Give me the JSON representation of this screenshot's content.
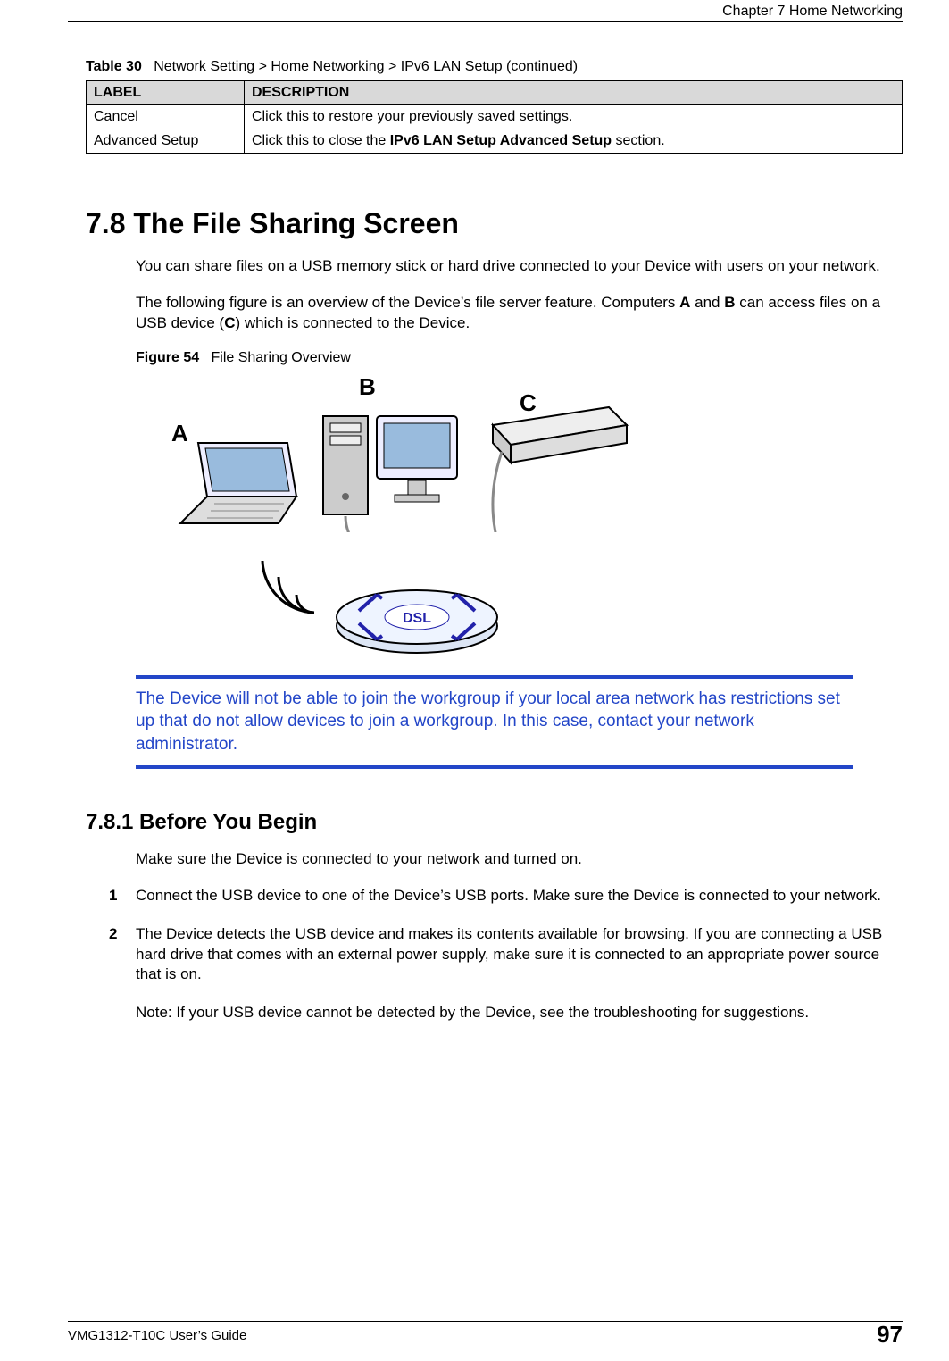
{
  "header": {
    "chapter": "Chapter 7 Home Networking"
  },
  "table": {
    "caption_prefix": "Table 30",
    "caption_body": "Network Setting > Home Networking > IPv6 LAN Setup (continued)",
    "col_label": "LABEL",
    "col_desc": "DESCRIPTION",
    "rows": [
      {
        "label": "Cancel",
        "desc_plain": "Click this to restore your previously saved settings."
      },
      {
        "label": "Advanced Setup",
        "desc_pre": "Click this to close the ",
        "desc_bold": "IPv6 LAN Setup Advanced Setup",
        "desc_post": " section."
      }
    ]
  },
  "section": {
    "number_title": "7.8  The File Sharing Screen",
    "para1": "You can share files on a USB memory stick or hard drive connected to your Device with users on your network.",
    "para2_pre": "The following figure is an overview of the Device’s file server feature. Computers ",
    "para2_A": "A",
    "para2_mid1": " and ",
    "para2_B": "B",
    "para2_mid2": " can access files on a USB device (",
    "para2_C": "C",
    "para2_post": ") which is connected to the Device."
  },
  "figure": {
    "caption_prefix": "Figure 54",
    "caption_body": "File Sharing Overview",
    "label_A": "A",
    "label_B": "B",
    "label_C": "C",
    "dsl_text": "DSL"
  },
  "callout": {
    "text": "The Device will not be able to join the workgroup if your local area network has restrictions set up that do not allow devices to join a workgroup. In this case, contact your network administrator."
  },
  "subsection": {
    "number_title": "7.8.1  Before You Begin",
    "intro": "Make sure the Device is connected to your network and turned on.",
    "steps": [
      {
        "n": "1",
        "text": "Connect the USB device to one of the Device’s USB ports. Make sure the Device is connected to your network."
      },
      {
        "n": "2",
        "text": "The Device detects the USB device and makes its contents available for browsing. If you are connecting a USB hard drive that comes with an external power supply, make sure it is connected to an appropriate power source that is on."
      }
    ],
    "note_label": "Note: ",
    "note_text": "If your USB device cannot be detected by the Device, see the troubleshooting for suggestions."
  },
  "footer": {
    "left": "VMG1312-T10C User’s Guide",
    "right": "97"
  }
}
